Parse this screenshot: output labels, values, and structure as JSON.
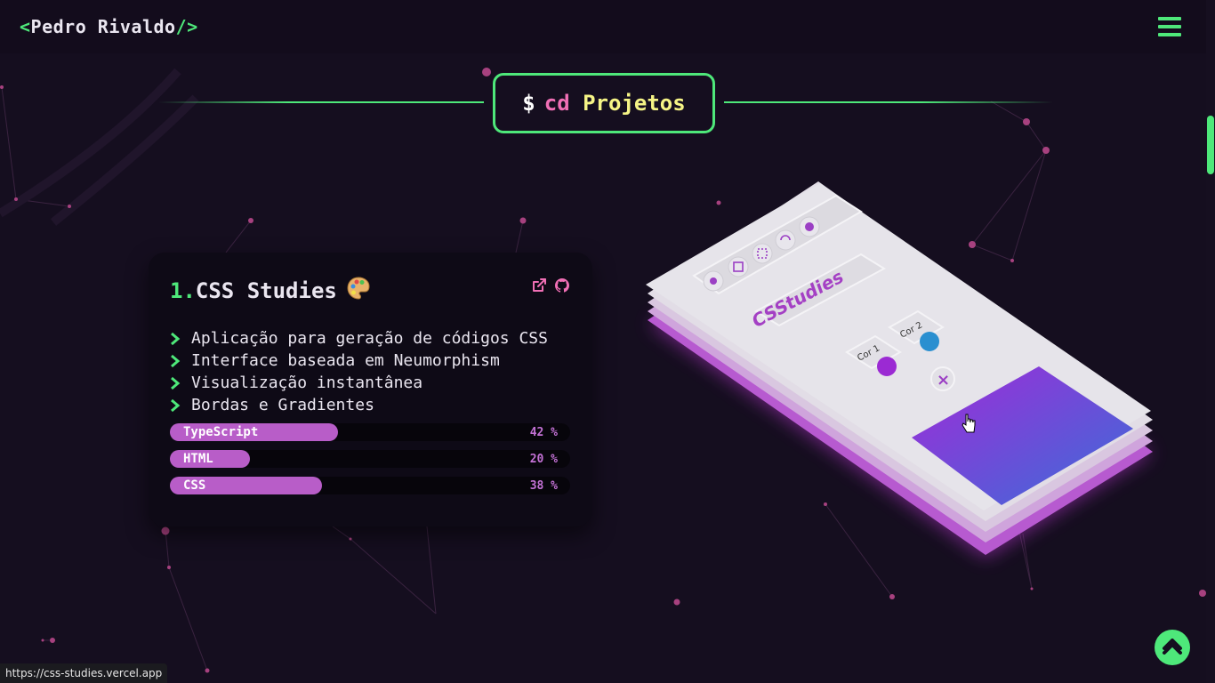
{
  "header": {
    "logo_open": "<",
    "logo_name": "Pedro Rivaldo",
    "logo_close": "/>"
  },
  "section": {
    "prompt": "$",
    "command": "cd",
    "directory": "Projetos"
  },
  "project": {
    "number": "1.",
    "title": "CSS Studies",
    "emoji": "🎨",
    "icons": [
      "external-link-icon",
      "github-icon"
    ],
    "features": [
      "Aplicação para geração de códigos CSS",
      "Interface baseada em Neumorphism",
      "Visualização instantânea",
      "Bordas e Gradientes"
    ],
    "languages": [
      {
        "name": "TypeScript",
        "percent": 42,
        "label": "42 %"
      },
      {
        "name": "HTML",
        "percent": 20,
        "label": "20 %"
      },
      {
        "name": "CSS",
        "percent": 38,
        "label": "38 %"
      }
    ]
  },
  "mockup": {
    "app_name": "CSStudies",
    "color1_label": "Cor 1",
    "color2_label": "Cor 2",
    "remove_symbol": "×"
  },
  "statusbar": {
    "url": "https://css-studies.vercel.app"
  },
  "colors": {
    "accent_green": "#4ee87a",
    "accent_purple": "#b85dc8",
    "command_pink": "#f06fb5",
    "directory_yellow": "#f6f486",
    "background": "#150e1f"
  }
}
